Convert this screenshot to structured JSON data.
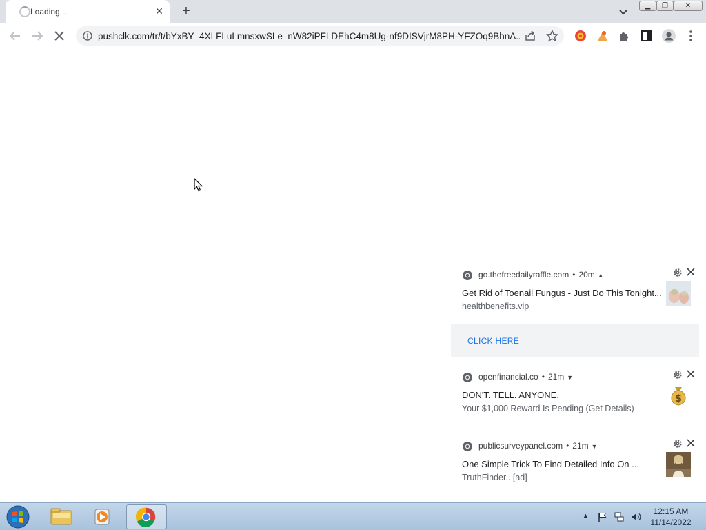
{
  "browser": {
    "tab": {
      "title": "Loading...",
      "close_icon": "close-icon",
      "loading_icon": "spinner-icon"
    },
    "new_tab_icon": "plus-icon",
    "tab_search_icon": "chevron-down-icon",
    "window_controls": [
      "minimize-icon",
      "maximize-icon",
      "close-icon"
    ],
    "toolbar": {
      "back_icon": "arrow-left-icon",
      "forward_icon": "arrow-right-icon",
      "stop_icon": "close-icon",
      "url": "pushclk.com/tr/t/bYxBY_4XLFLuLmnsxwSLe_nW82iPFLDEhC4m8Ug-nf9DISVjrM8PH-YFZOq9BhnA...",
      "site_info_icon": "info-icon",
      "share_icon": "share-icon",
      "bookmark_icon": "star-icon",
      "extensions": [
        "extension-red-icon",
        "extension-orange-icon",
        "puzzle-icon"
      ],
      "side_panel_icon": "side-panel-icon",
      "profile_icon": "avatar-icon",
      "menu_icon": "more-vertical-icon"
    }
  },
  "notifications": [
    {
      "source": "go.thefreedailyraffle.com",
      "time": "20m",
      "chevron": "^",
      "title": "Get Rid of Toenail Fungus - Just Do This Tonight...",
      "body": "healthbenefits.vip",
      "image": "toenail-image",
      "action": "CLICK HERE"
    },
    {
      "source": "openfinancial.co",
      "time": "21m",
      "chevron": "v",
      "title": "DON'T. TELL. ANYONE.",
      "body": "Your $1,000 Reward Is Pending (Get Details)",
      "image": "money-bag-icon"
    },
    {
      "source": "publicsurveypanel.com",
      "time": "21m",
      "chevron": "v",
      "title": "One Simple Trick To Find Detailed Info On ...",
      "body": "TruthFinder.. [ad]",
      "image": "person-photo-image"
    }
  ],
  "taskbar": {
    "apps": [
      "windows-start-icon",
      "file-explorer-icon",
      "media-player-icon",
      "chrome-icon"
    ],
    "tray": [
      "show-hidden-icons-icon",
      "action-center-flag-icon",
      "network-icon",
      "volume-icon"
    ],
    "clock": {
      "time": "12:15 AM",
      "date": "11/14/2022"
    }
  },
  "colors": {
    "accent": "#1a73e8",
    "tabstrip": "#dee1e6",
    "taskbar": "#b6cce4"
  }
}
